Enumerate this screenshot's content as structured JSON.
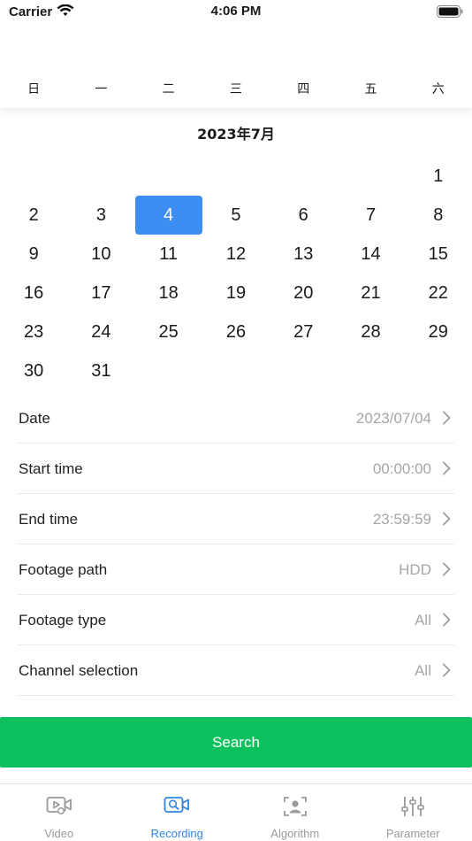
{
  "status_bar": {
    "carrier": "Carrier",
    "time": "4:06 PM"
  },
  "calendar": {
    "weekdays": [
      "日",
      "一",
      "二",
      "三",
      "四",
      "五",
      "六"
    ],
    "month_title": "2023年7月",
    "first_weekday_index": 6,
    "days_in_month": 31,
    "selected_day": 4
  },
  "settings": [
    {
      "label": "Date",
      "value": "2023/07/04"
    },
    {
      "label": "Start time",
      "value": "00:00:00"
    },
    {
      "label": "End time",
      "value": "23:59:59"
    },
    {
      "label": "Footage path",
      "value": "HDD"
    },
    {
      "label": "Footage type",
      "value": "All"
    },
    {
      "label": "Channel selection",
      "value": "All"
    }
  ],
  "search_label": "Search",
  "tabs": [
    {
      "label": "Video",
      "icon": "video-icon",
      "active": false
    },
    {
      "label": "Recording",
      "icon": "recording-icon",
      "active": true
    },
    {
      "label": "Algorithm",
      "icon": "algorithm-icon",
      "active": false
    },
    {
      "label": "Parameter",
      "icon": "parameter-icon",
      "active": false
    }
  ],
  "colors": {
    "accent": "#3d8ef2",
    "active_tab": "#2f86e0",
    "button": "#0dc05e",
    "muted": "#a6a6a6"
  }
}
